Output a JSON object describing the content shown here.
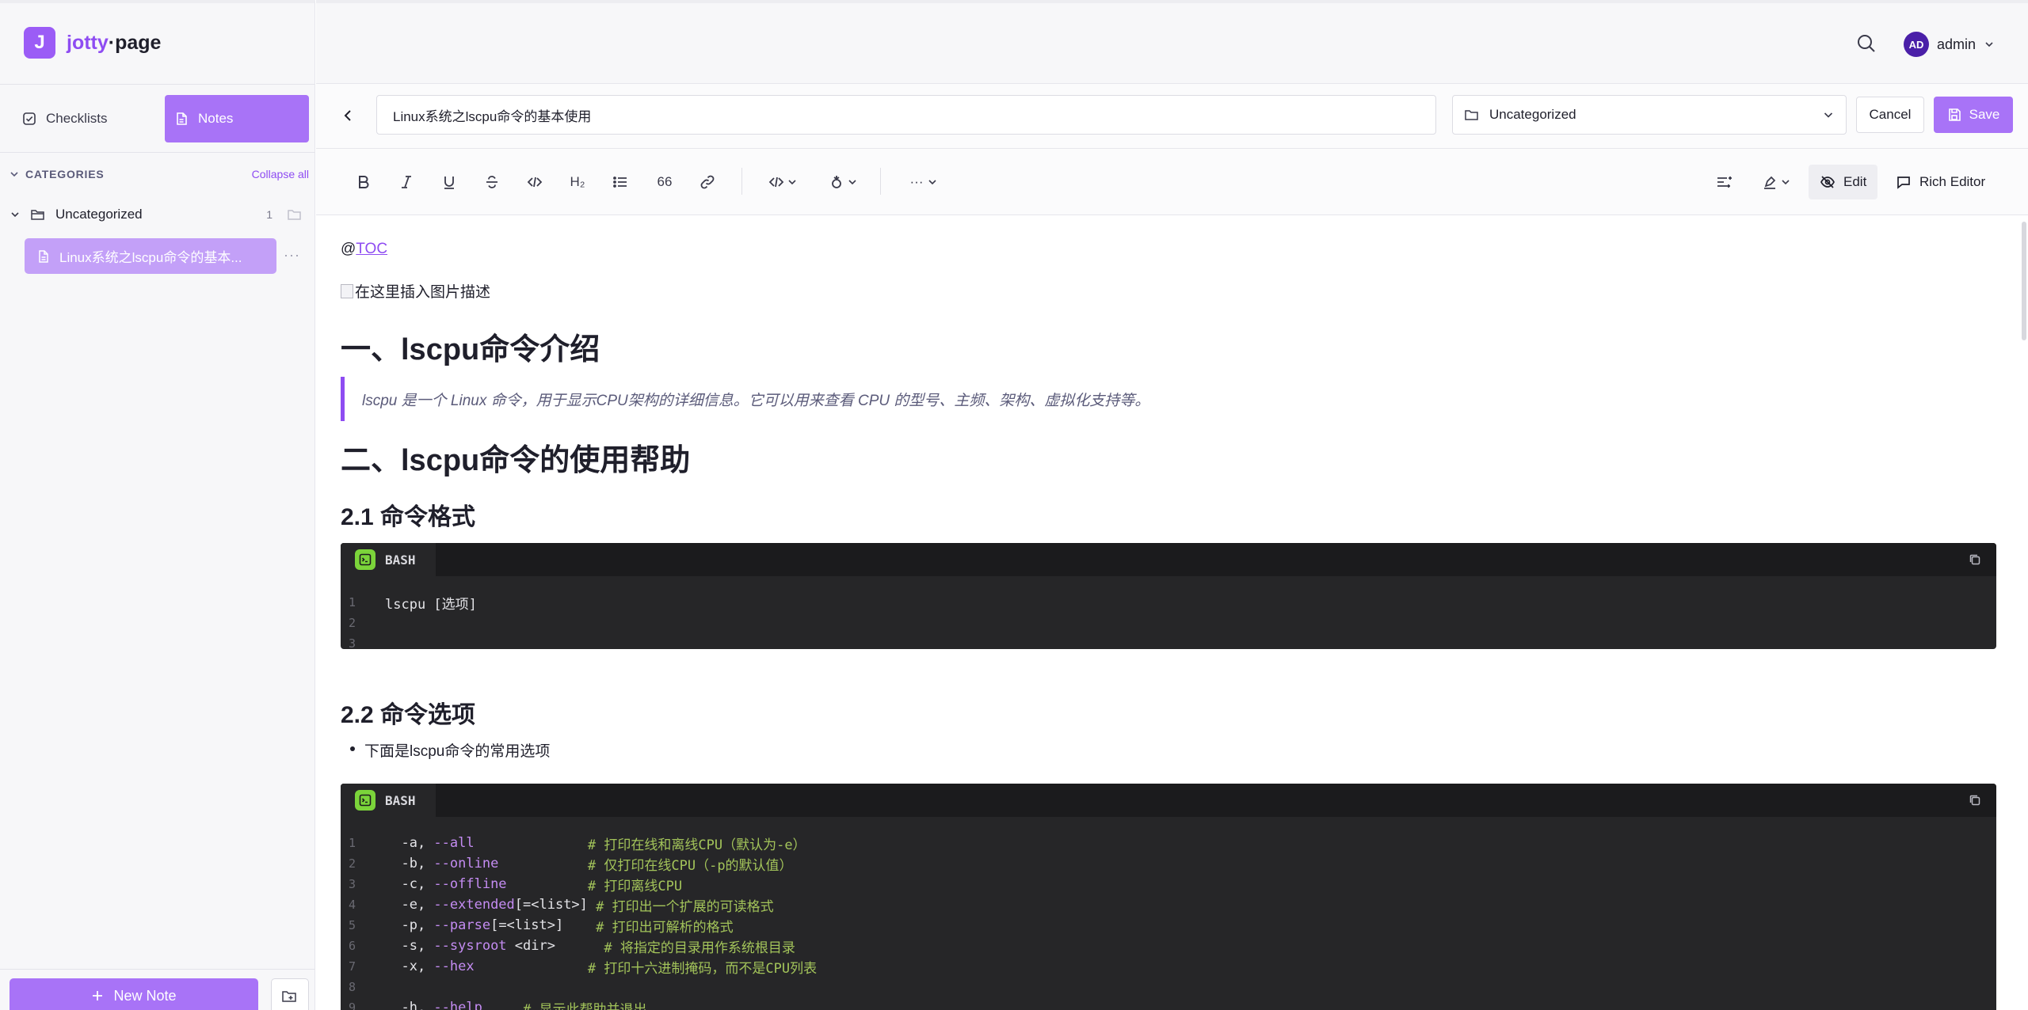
{
  "app": {
    "logo_mark": "J",
    "logo_left": "jotty",
    "logo_right": "·page"
  },
  "sidebar": {
    "tabs": [
      {
        "label": "Checklists",
        "active": false
      },
      {
        "label": "Notes",
        "active": true
      }
    ],
    "categories_title": "CATEGORIES",
    "collapse_label": "Collapse all",
    "category": {
      "name": "Uncategorized",
      "count": "1"
    },
    "note_item": "Linux系统之lscpu命令的基本...",
    "note_more": "···",
    "new_note_label": "New Note"
  },
  "header": {
    "user": {
      "initials": "AD",
      "name": "admin"
    }
  },
  "editor": {
    "title_value": "Linux系统之lscpu命令的基本使用",
    "category_value": "Uncategorized",
    "cancel_label": "Cancel",
    "save_label": "Save",
    "toolbar": {
      "heading_label": "H₂",
      "quote_label": "66",
      "more_label": "···",
      "edit_label": "Edit",
      "rich_editor_label": "Rich Editor"
    }
  },
  "document": {
    "toc_prefix": "@",
    "toc_link": "TOC",
    "image_alt": "在这里插入图片描述",
    "h1_intro": "一、lscpu命令介绍",
    "quote": "lscpu 是一个 Linux 命令，用于显示CPU架构的详细信息。它可以用来查看 CPU 的型号、主频、架构、虚拟化支持等。",
    "h1_help": "二、lscpu命令的使用帮助",
    "h2_format": "2.1 命令格式",
    "code1": {
      "lang": "BASH",
      "lines": [
        {
          "n": "1",
          "text": "lscpu [选项]"
        },
        {
          "n": "2",
          "text": ""
        },
        {
          "n": "3",
          "text": ""
        }
      ]
    },
    "h2_options": "2.2 命令选项",
    "bullet": "下面是lscpu命令的常用选项",
    "code2": {
      "lang": "BASH",
      "lines": [
        {
          "n": "1",
          "pre": "  -a, ",
          "kw": "--all",
          "pad": "              ",
          "cm": "# 打印在线和离线CPU（默认为-e）"
        },
        {
          "n": "2",
          "pre": "  -b, ",
          "kw": "--online",
          "pad": "           ",
          "cm": "# 仅打印在线CPU（-p的默认值）"
        },
        {
          "n": "3",
          "pre": "  -c, ",
          "kw": "--offline",
          "pad": "          ",
          "cm": "# 打印离线CPU"
        },
        {
          "n": "4",
          "pre": "  -e, ",
          "kw": "--extended",
          "pad": "[=<list>] ",
          "cm": "# 打印出一个扩展的可读格式"
        },
        {
          "n": "5",
          "pre": "  -p, ",
          "kw": "--parse",
          "pad": "[=<list>]    ",
          "cm": "# 打印出可解析的格式"
        },
        {
          "n": "6",
          "pre": "  -s, ",
          "kw": "--sysroot",
          "pad": " <dir>      ",
          "cm": "# 将指定的目录用作系统根目录"
        },
        {
          "n": "7",
          "pre": "  -x, ",
          "kw": "--hex",
          "pad": "              ",
          "cm": "# 打印十六进制掩码，而不是CPU列表"
        },
        {
          "n": "8",
          "pre": "",
          "kw": "",
          "pad": "",
          "cm": ""
        },
        {
          "n": "9",
          "pre": "  -h, ",
          "kw": "--help",
          "pad": "     ",
          "cm": "# 显示此帮助并退出"
        }
      ]
    }
  }
}
